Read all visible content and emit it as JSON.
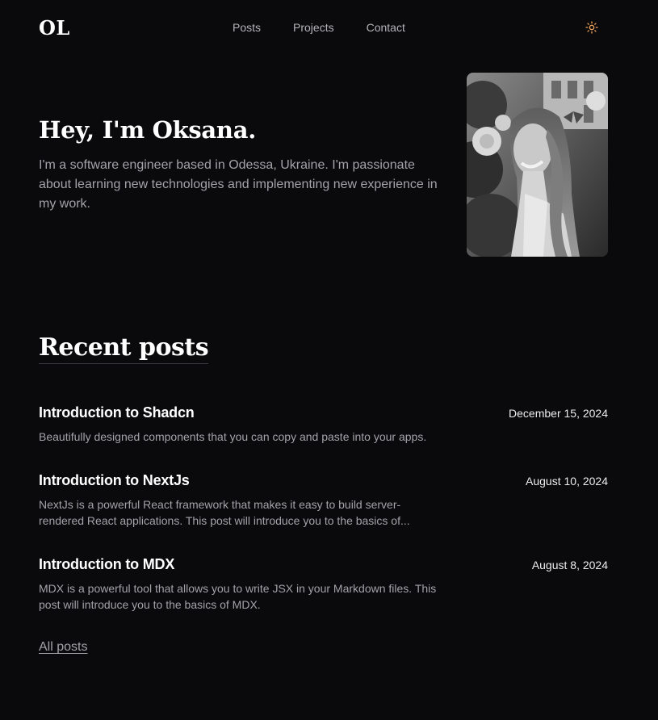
{
  "header": {
    "logo": "OL",
    "nav": [
      "Posts",
      "Projects",
      "Contact"
    ],
    "theme_toggle_icon": "sun-icon",
    "theme_toggle_color": "#f0a35a"
  },
  "hero": {
    "title": "Hey, I'm Oksana.",
    "description": "I'm a software engineer based in Odessa, Ukraine. I'm passionate about learning new technologies and implementing new experience in my work.",
    "photo_icon": "portrait-photo"
  },
  "recent_posts": {
    "heading": "Recent posts",
    "posts": [
      {
        "title": "Introduction to Shadcn",
        "date": "December 15, 2024",
        "description": "Beautifully designed components that you can copy and paste into your apps."
      },
      {
        "title": "Introduction to NextJs",
        "date": "August 10, 2024",
        "description": "NextJs is a powerful React framework that makes it easy to build server-rendered React applications. This post will introduce you to the basics of..."
      },
      {
        "title": "Introduction to MDX",
        "date": "August 8, 2024",
        "description": "MDX is a powerful tool that allows you to write JSX in your Markdown files. This post will introduce you to the basics of MDX."
      }
    ],
    "all_posts_label": "All posts"
  }
}
